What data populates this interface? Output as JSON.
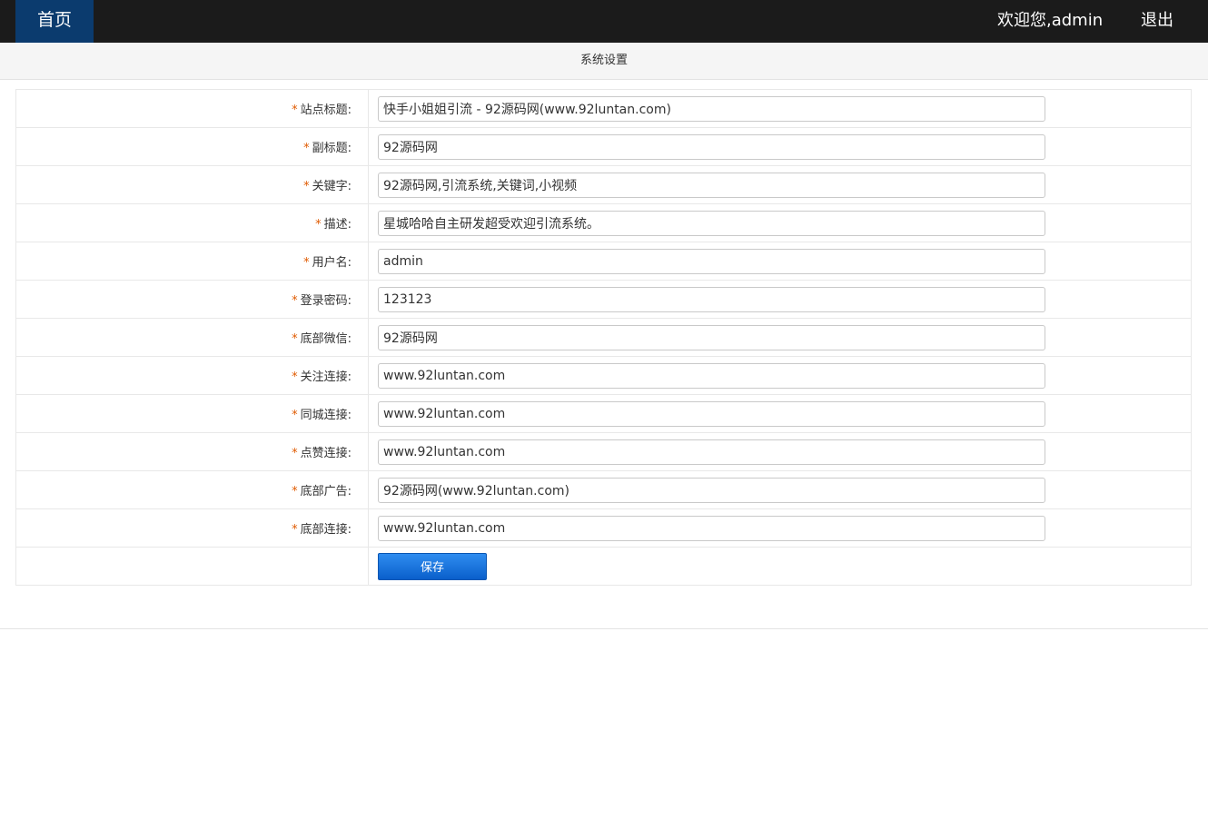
{
  "nav": {
    "home_label": "首页",
    "welcome_text": "欢迎您,admin",
    "logout_label": "退出"
  },
  "page": {
    "title": "系统设置"
  },
  "form": {
    "required_mark": "*",
    "fields": [
      {
        "label": "站点标题:",
        "value": "快手小姐姐引流 - 92源码网(www.92luntan.com)"
      },
      {
        "label": "副标题:",
        "value": "92源码网"
      },
      {
        "label": "关键字:",
        "value": "92源码网,引流系统,关键词,小视频"
      },
      {
        "label": "描述:",
        "value": "星城哈哈自主研发超受欢迎引流系统。"
      },
      {
        "label": "用户名:",
        "value": "admin"
      },
      {
        "label": "登录密码:",
        "value": "123123"
      },
      {
        "label": "底部微信:",
        "value": "92源码网"
      },
      {
        "label": "关注连接:",
        "value": "www.92luntan.com"
      },
      {
        "label": "同城连接:",
        "value": "www.92luntan.com"
      },
      {
        "label": "点赞连接:",
        "value": "www.92luntan.com"
      },
      {
        "label": "底部广告:",
        "value": "92源码网(www.92luntan.com)"
      },
      {
        "label": "底部连接:",
        "value": "www.92luntan.com"
      }
    ],
    "save_label": "保存"
  },
  "colors": {
    "topbar": "#1b1b1b",
    "home_tab": "#0b3b6e",
    "required": "#e05a00",
    "button": "#0a5fcb"
  }
}
